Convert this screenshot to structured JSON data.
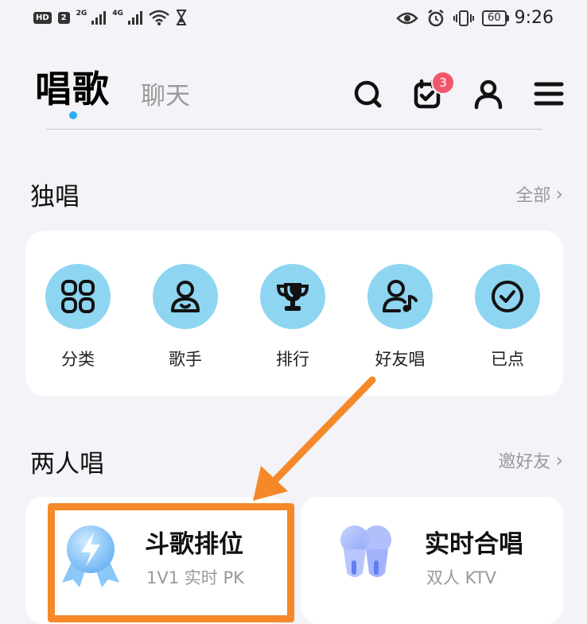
{
  "status_bar": {
    "hd_label": "HD",
    "sim_label": "2",
    "net1": "2G",
    "net2": "4G",
    "battery": "60",
    "time": "9:26"
  },
  "header": {
    "tab_active": "唱歌",
    "tab_inactive": "聊天",
    "notification_count": "3",
    "icons": [
      "search-icon",
      "calendar-check-icon",
      "user-icon",
      "menu-icon"
    ]
  },
  "solo": {
    "title": "独唱",
    "link": "全部",
    "items": [
      {
        "label": "分类",
        "icon": "grid-icon"
      },
      {
        "label": "歌手",
        "icon": "singer-icon"
      },
      {
        "label": "排行",
        "icon": "trophy-icon"
      },
      {
        "label": "好友唱",
        "icon": "friend-sing-icon"
      },
      {
        "label": "已点",
        "icon": "check-circle-icon"
      }
    ]
  },
  "duo": {
    "title": "两人唱",
    "link": "邀好友",
    "cards": [
      {
        "title": "斗歌排位",
        "subtitle": "1V1 实时 PK",
        "icon": "lightning-medal-icon"
      },
      {
        "title": "实时合唱",
        "subtitle": "双人 KTV",
        "icon": "microphones-icon"
      }
    ]
  },
  "colors": {
    "accent_dot": "#2ab0f0",
    "icon_circle": "#8ed5f2",
    "badge": "#f0576c",
    "highlight": "#f5892a"
  }
}
